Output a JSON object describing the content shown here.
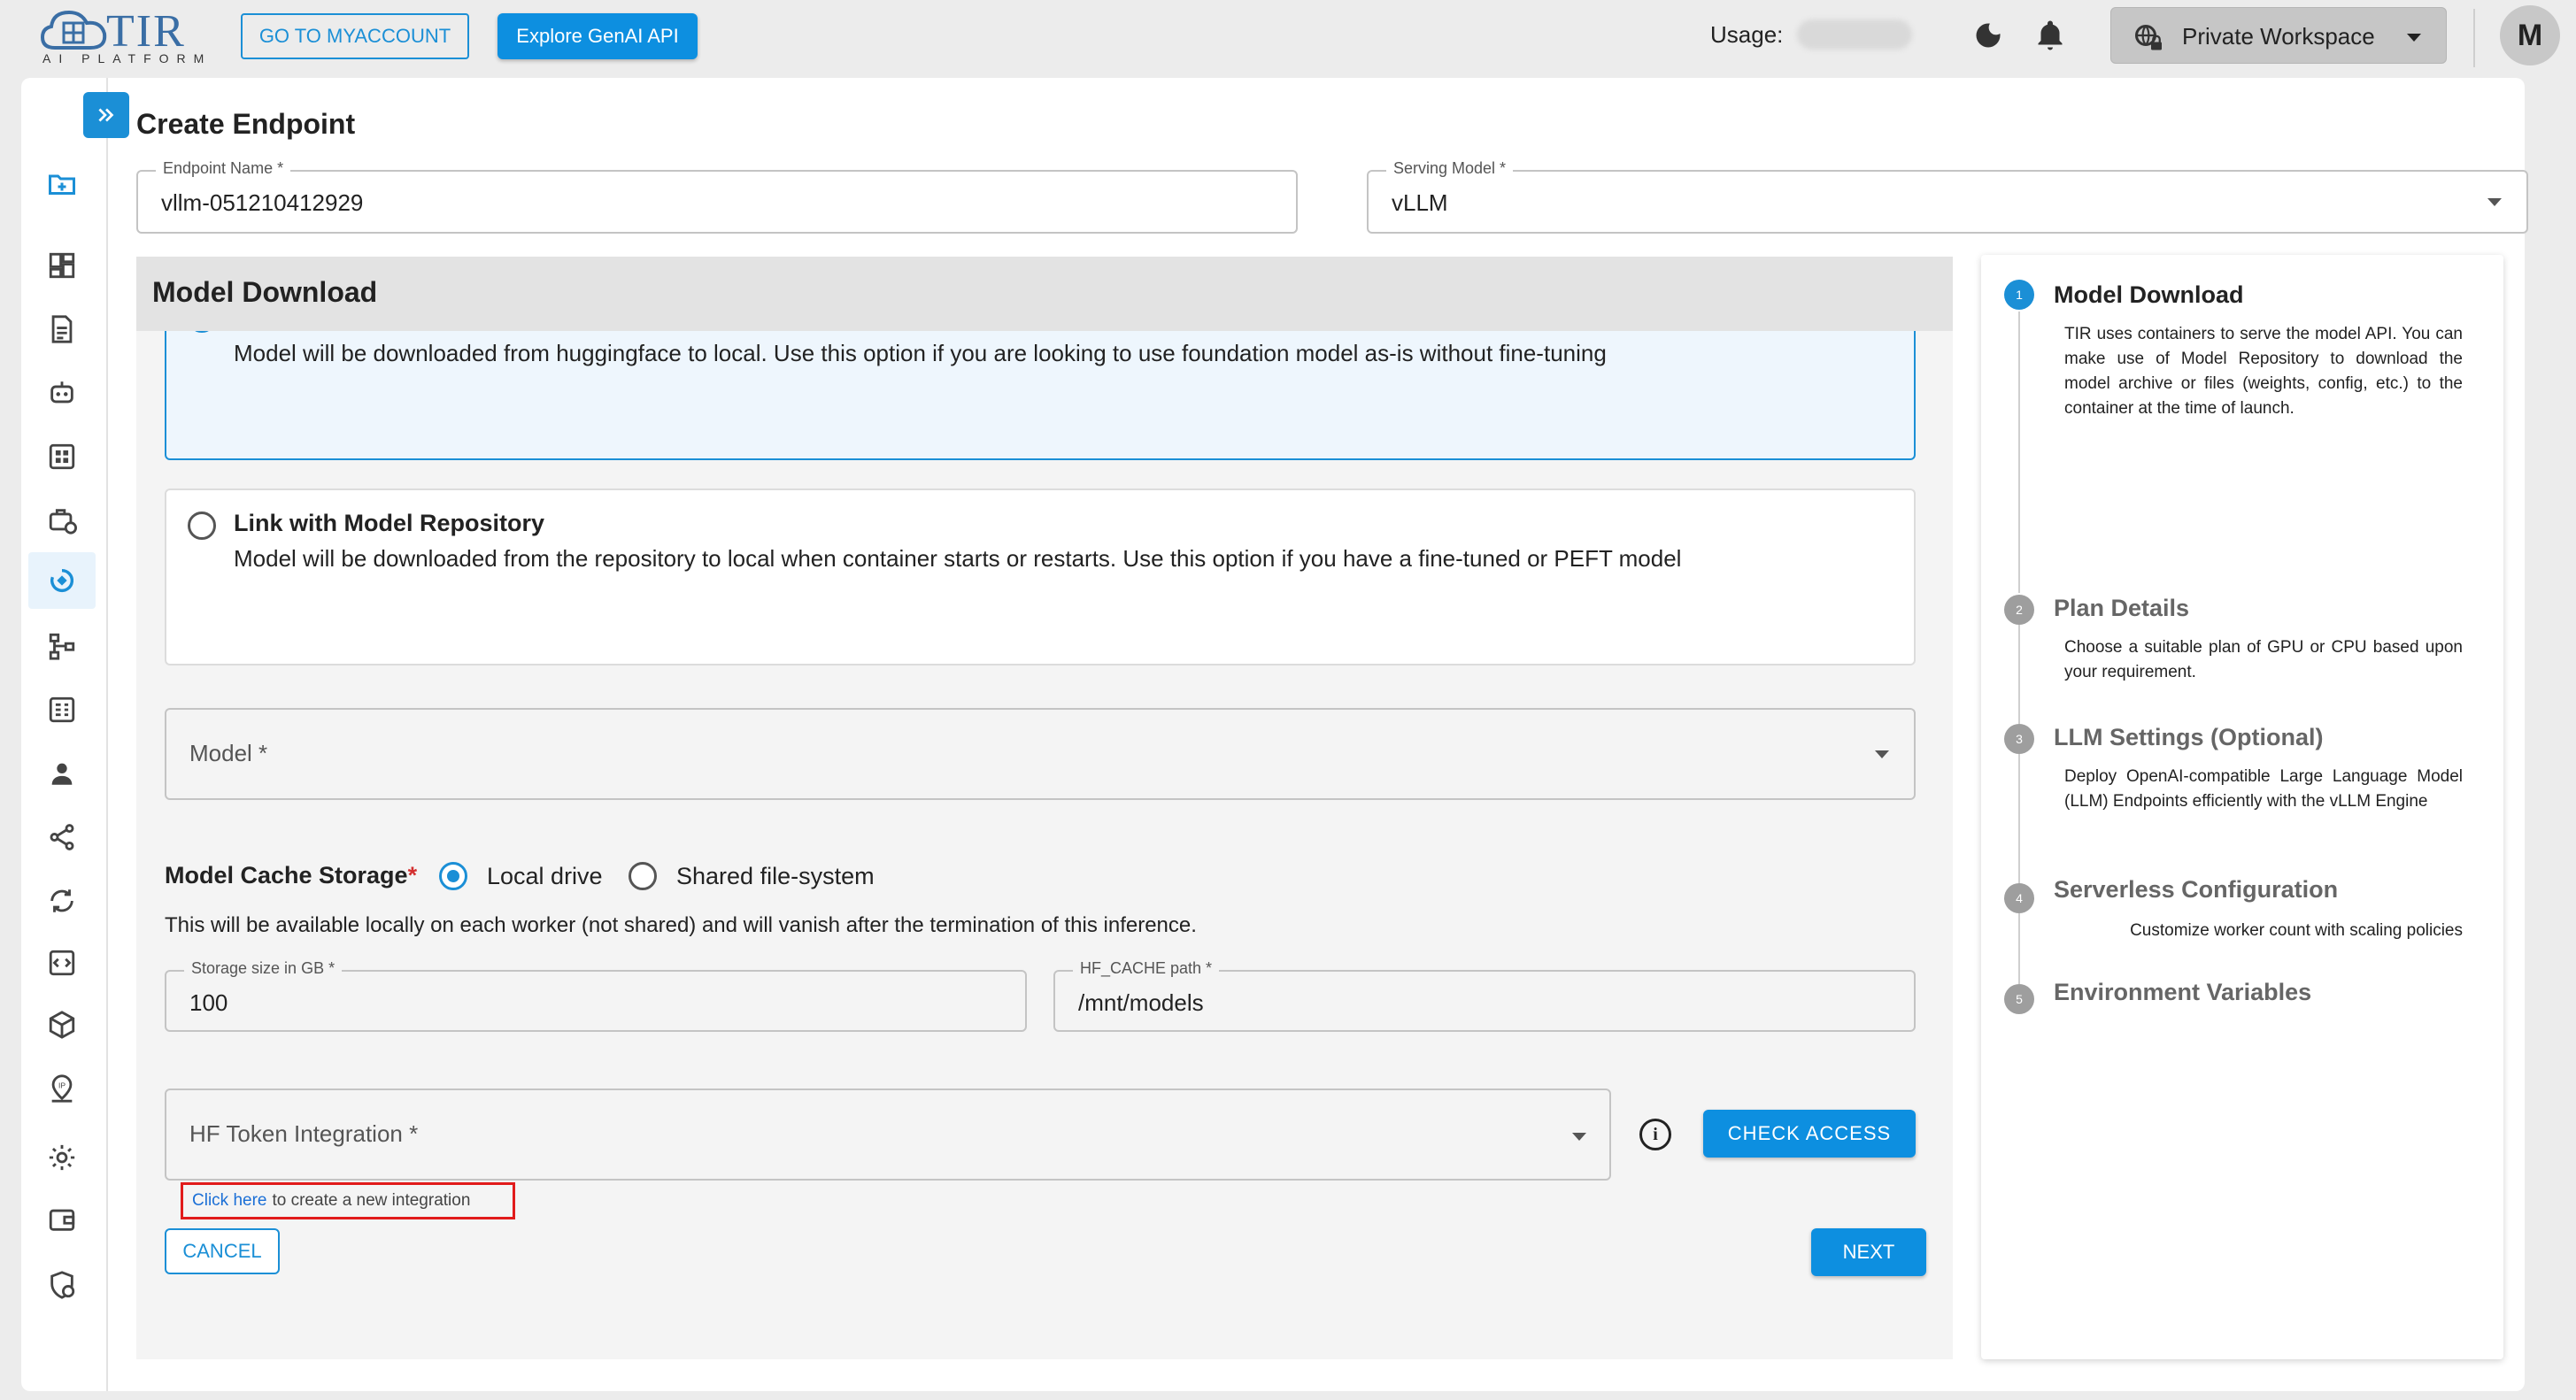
{
  "header": {
    "logo_text": "TIR",
    "logo_subtext": "AI PLATFORM",
    "myaccount_button": "GO TO MYACCOUNT",
    "genai_button": "Explore GenAI API",
    "usage_label": "Usage:",
    "workspace_label": "Private Workspace",
    "avatar_initial": "M"
  },
  "page": {
    "title": "Create Endpoint"
  },
  "form": {
    "endpoint_name_label": "Endpoint Name *",
    "endpoint_name_value": "vllm-051210412929",
    "serving_model_label": "Serving Model *",
    "serving_model_value": "vLLM"
  },
  "model_download": {
    "title": "Model Download",
    "option_huggingface_desc": "Model will be downloaded from huggingface to local. Use this option if you are looking to use foundation model as-is without fine-tuning",
    "option_repo_title": "Link with Model Repository",
    "option_repo_desc": "Model will be downloaded from the repository to local when container starts or restarts. Use this option if you have a fine-tuned or PEFT model",
    "model_placeholder": "Model *",
    "cache_storage_label": "Model Cache Storage",
    "cache_required_mark": "*",
    "cache_options": [
      "Local drive",
      "Shared file-system"
    ],
    "cache_selected": "Local drive",
    "cache_note": "This will be available locally on each worker (not shared) and will vanish after the termination of this inference.",
    "storage_size_label": "Storage size in GB *",
    "storage_size_value": "100",
    "hf_cache_label": "HF_CACHE path *",
    "hf_cache_value": "/mnt/models",
    "hf_token_placeholder": "HF Token Integration *",
    "check_access_button": "CHECK ACCESS",
    "create_link_text": "Click here",
    "create_link_suffix": "to create a new integration",
    "cancel_button": "CANCEL",
    "next_button": "NEXT"
  },
  "stepper": {
    "steps": [
      {
        "number": "1",
        "title": "Model Download",
        "desc": "TIR uses containers to serve the model API. You can make use of Model Repository to download the model archive or files (weights, config, etc.) to the container at the time of launch."
      },
      {
        "number": "2",
        "title": "Plan Details",
        "desc": "Choose a suitable plan of GPU or CPU based upon your requirement."
      },
      {
        "number": "3",
        "title": "LLM Settings (Optional)",
        "desc": "Deploy OpenAI-compatible Large Language Model (LLM) Endpoints efficiently with the vLLM Engine"
      },
      {
        "number": "4",
        "title": "Serverless Configuration",
        "desc": "Customize worker count with scaling policies"
      },
      {
        "number": "5",
        "title": "Environment Variables",
        "desc": ""
      }
    ]
  },
  "sidebar": {
    "icons": [
      "new-project-icon",
      "dashboard-icon",
      "notebook-icon",
      "bot-icon",
      "apps-icon",
      "job-icon",
      "inference-icon",
      "pipeline-icon",
      "registry-icon",
      "user-icon",
      "share-icon",
      "sync-icon",
      "code-icon",
      "package-icon",
      "ip-icon",
      "settings-icon",
      "wallet-icon",
      "security-icon"
    ]
  },
  "colors": {
    "accent": "#1b8fd6",
    "required": "#d32f2f",
    "highlight_box": "#e11b1b"
  }
}
